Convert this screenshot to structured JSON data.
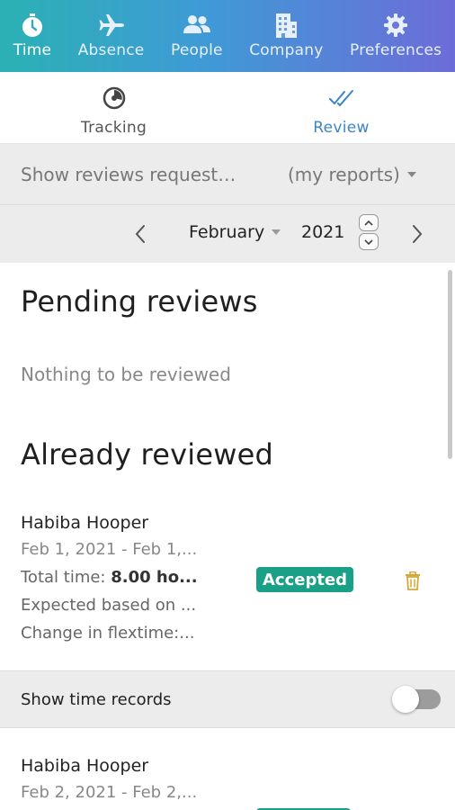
{
  "topnav": {
    "items": [
      {
        "label": "Time",
        "icon": "stopwatch-icon",
        "active": true
      },
      {
        "label": "Absence",
        "icon": "airplane-icon",
        "active": false
      },
      {
        "label": "People",
        "icon": "people-icon",
        "active": false
      },
      {
        "label": "Company",
        "icon": "building-icon",
        "active": false
      },
      {
        "label": "Preferences",
        "icon": "gear-icon",
        "active": false
      }
    ]
  },
  "subtabs": {
    "items": [
      {
        "label": "Tracking",
        "icon": "timer-icon",
        "active": false
      },
      {
        "label": "Review",
        "icon": "double-check-icon",
        "active": true
      }
    ]
  },
  "filter": {
    "text": "Show reviews request…",
    "select_value": "(my reports)"
  },
  "period": {
    "month": "February",
    "year": "2021"
  },
  "pending": {
    "title": "Pending reviews",
    "empty_text": "Nothing to be reviewed"
  },
  "reviewed": {
    "title": "Already reviewed",
    "entries": [
      {
        "name": "Habiba Hooper",
        "date_range": "Feb 1, 2021 - Feb 1,...",
        "total_label": "Total time:",
        "total_value": "8.00 ho...",
        "expected": "Expected based on ...",
        "flextime": "Change in flextime:...",
        "status": "Accepted"
      },
      {
        "name": "Habiba Hooper",
        "date_range": "Feb 2, 2021 - Feb 2,..."
      }
    ]
  },
  "records": {
    "label": "Show time records",
    "enabled": false
  },
  "colors": {
    "accent": "#3a86c8",
    "badge": "#1aa086",
    "trash": "#d4a93a"
  }
}
